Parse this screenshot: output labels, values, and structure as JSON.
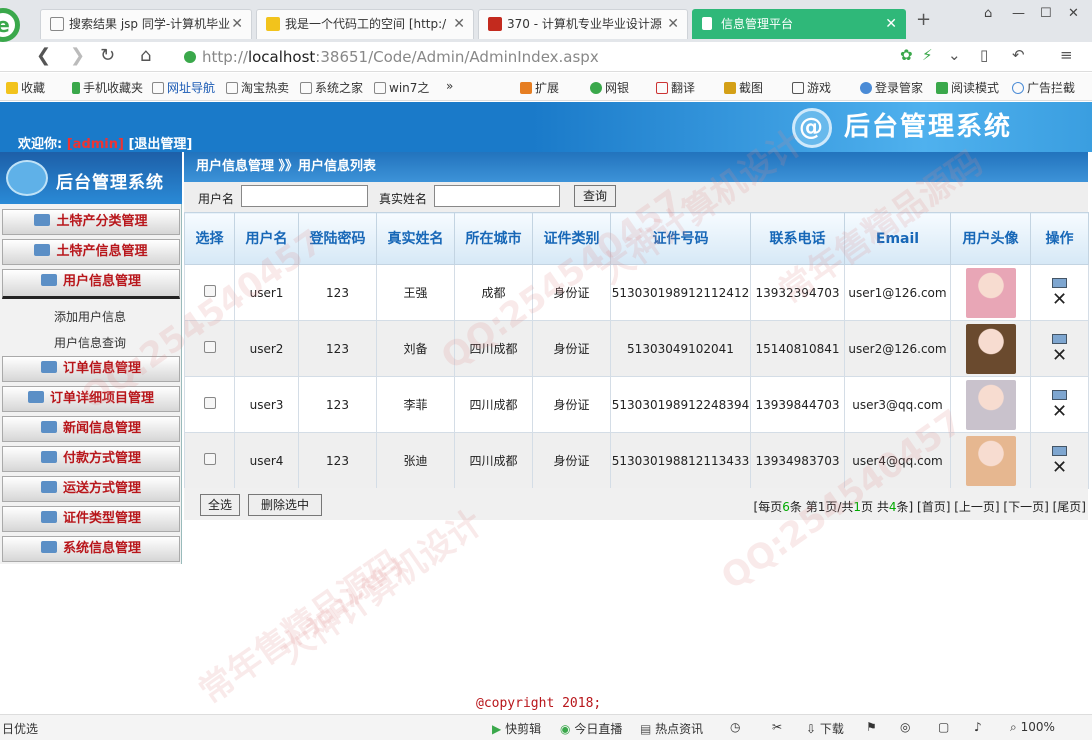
{
  "browser": {
    "tabs": [
      {
        "label": "搜索结果 jsp 同学-计算机毕业"
      },
      {
        "label": "我是一个代码工的空间 [http:/"
      },
      {
        "label": "370 - 计算机专业毕业设计源"
      },
      {
        "label": "信息管理平台"
      }
    ],
    "url_prefix": "http://",
    "url_host": "localhost",
    "url_rest": ":38651/Code/Admin/AdminIndex.aspx",
    "favorites": [
      "收藏",
      "手机收藏夹",
      "网址导航",
      "淘宝热卖",
      "系统之家",
      "win7之",
      "扩展",
      "网银",
      "翻译",
      "截图",
      "游戏",
      "登录管家",
      "阅读模式",
      "广告拦截"
    ]
  },
  "header": {
    "welcome": "欢迎你:",
    "user": "[admin]",
    "logout": "[退出管理]",
    "brand": "后台管理系统"
  },
  "sidebar": {
    "brand": "后台管理系统",
    "items": [
      {
        "label": "土特产分类管理"
      },
      {
        "label": "土特产信息管理"
      },
      {
        "label": "用户信息管理"
      },
      {
        "label": "订单信息管理"
      },
      {
        "label": "订单详细项目管理"
      },
      {
        "label": "新闻信息管理"
      },
      {
        "label": "付款方式管理"
      },
      {
        "label": "运送方式管理"
      },
      {
        "label": "证件类型管理"
      },
      {
        "label": "系统信息管理"
      }
    ],
    "subitems": [
      "添加用户信息",
      "用户信息查询"
    ]
  },
  "main": {
    "breadcrumb": "用户信息管理 》》用户信息列表",
    "search": {
      "username_label": "用户名",
      "username_value": "",
      "realname_label": "真实姓名",
      "realname_value": "",
      "query_button": "查询"
    },
    "columns": [
      "选择",
      "用户名",
      "登陆密码",
      "真实姓名",
      "所在城市",
      "证件类别",
      "证件号码",
      "联系电话",
      "Email",
      "用户头像",
      "操作"
    ],
    "rows": [
      {
        "username": "user1",
        "password": "123",
        "realname": "王强",
        "city": "成都",
        "idtype": "身份证",
        "idno": "513030198912112412",
        "phone": "13932394703",
        "email": "user1@126.com",
        "avatar_color": "#e8a6b6"
      },
      {
        "username": "user2",
        "password": "123",
        "realname": "刘备",
        "city": "四川成都",
        "idtype": "身份证",
        "idno": "51303049102041",
        "phone": "15140810841",
        "email": "user2@126.com",
        "avatar_color": "#6a4a2e"
      },
      {
        "username": "user3",
        "password": "123",
        "realname": "李菲",
        "city": "四川成都",
        "idtype": "身份证",
        "idno": "513030198912248394",
        "phone": "13939844703",
        "email": "user3@qq.com",
        "avatar_color": "#c9c2cc"
      },
      {
        "username": "user4",
        "password": "123",
        "realname": "张迪",
        "city": "四川成都",
        "idtype": "身份证",
        "idno": "513030198812113433",
        "phone": "13934983703",
        "email": "user4@qq.com",
        "avatar_color": "#e6b790"
      }
    ],
    "select_all": "全选",
    "delete_selected": "删除选中",
    "pager": {
      "prefix": "[每页",
      "per_page": "6",
      "mid1": "条 第",
      "page": "1",
      "mid2": "页/共",
      "total_pages": "1",
      "mid3": "页 共",
      "total": "4",
      "suffix": "条]",
      "first": "[首页]",
      "prev": "[上一页]",
      "next": "[下一页]",
      "last": "[尾页]"
    }
  },
  "copyright": "@copyright 2018;",
  "statusbar": {
    "left": "日优选",
    "items": [
      "快剪辑",
      "今日直播",
      "热点资讯",
      "下载"
    ],
    "zoom": "100%"
  },
  "watermarks": [
    "QQ:254540457",
    "大神计算机设计",
    "常年售精品源码"
  ]
}
